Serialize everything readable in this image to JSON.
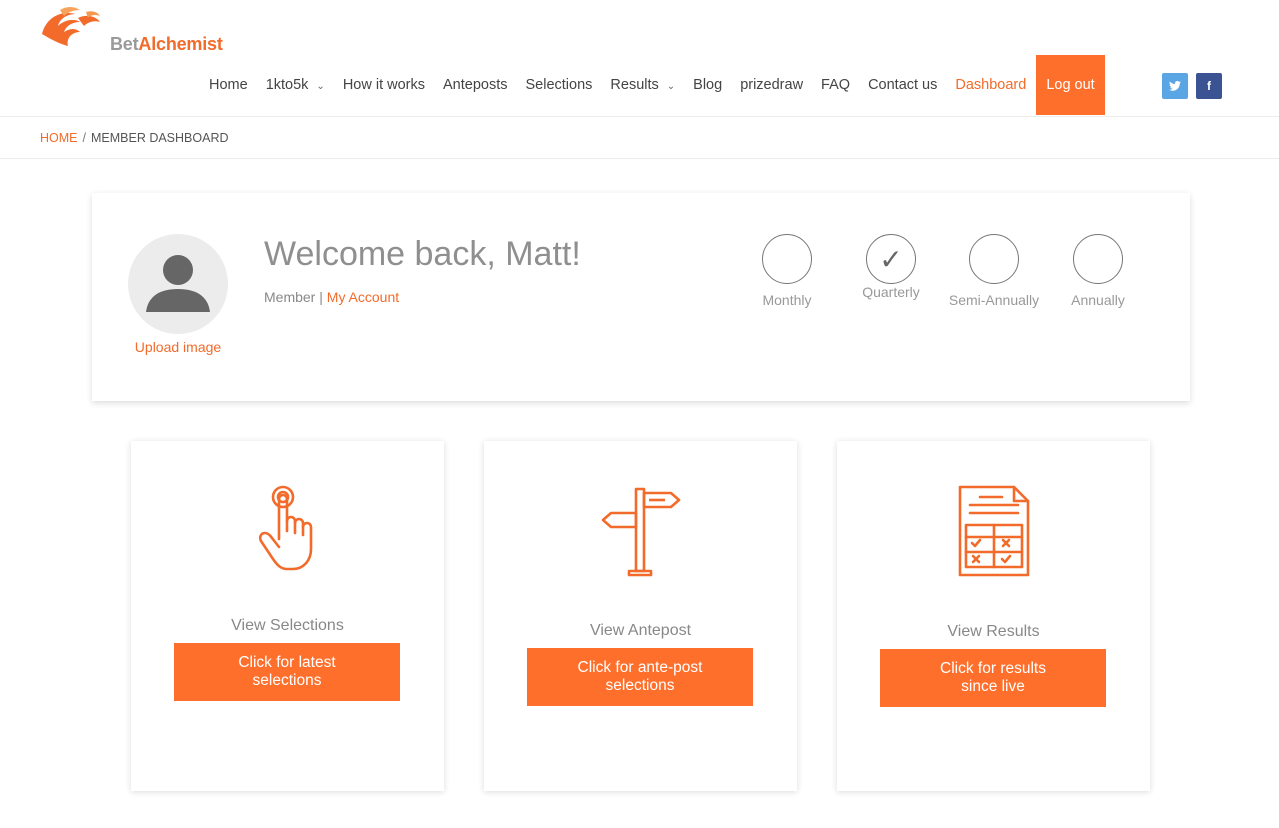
{
  "brand": {
    "name_part1": "Bet",
    "name_part2": "Alchemist",
    "logo_icon": "phoenix-logo",
    "accent_color": "#ff6f2c"
  },
  "nav": {
    "items": [
      {
        "label": "Home"
      },
      {
        "label": "1kto5k",
        "has_dropdown": true
      },
      {
        "label": "How it works"
      },
      {
        "label": "Anteposts"
      },
      {
        "label": "Selections"
      },
      {
        "label": "Results",
        "has_dropdown": true
      },
      {
        "label": "Blog"
      },
      {
        "label": "prizedraw"
      },
      {
        "label": "FAQ"
      },
      {
        "label": "Contact us"
      },
      {
        "label": "Dashboard",
        "active": true
      }
    ],
    "logout_label": "Log out",
    "dropdown_icon": "chevron-down-icon",
    "twitter_glyph": "t",
    "facebook_glyph": "f"
  },
  "breadcrumb": {
    "home": "HOME",
    "separator": "/",
    "current": "MEMBER DASHBOARD"
  },
  "welcome": {
    "title": "Welcome back, Matt!",
    "role": "Member",
    "separator": "|",
    "account_link": "My Account",
    "upload_label": "Upload image",
    "plans": [
      {
        "label": "Monthly",
        "checked": false
      },
      {
        "label": "Quarterly",
        "checked": true
      },
      {
        "label": "Semi-Annually",
        "checked": false
      },
      {
        "label": "Annually",
        "checked": false
      }
    ],
    "check_glyph": "✓"
  },
  "features": [
    {
      "icon": "pointing-hand-icon",
      "title": "View Selections",
      "button": "Click for latest selections"
    },
    {
      "icon": "signpost-icon",
      "title": "View Antepost",
      "button": "Click for ante-post selections"
    },
    {
      "icon": "results-document-icon",
      "title": "View Results",
      "button": "Click for results since live"
    }
  ]
}
